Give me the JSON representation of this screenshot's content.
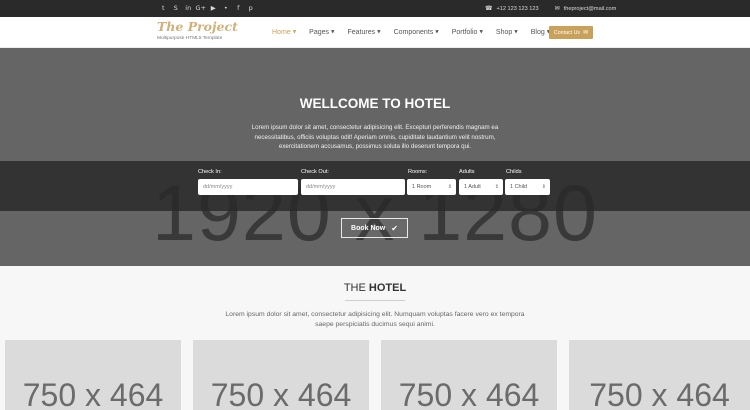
{
  "topbar": {
    "social": [
      {
        "icon": "twitter-icon",
        "glyph": "t"
      },
      {
        "icon": "skype-icon",
        "glyph": "S"
      },
      {
        "icon": "linkedin-icon",
        "glyph": "in"
      },
      {
        "icon": "google-plus-icon",
        "glyph": "G+"
      },
      {
        "icon": "youtube-icon",
        "glyph": "▶"
      },
      {
        "icon": "flickr-icon",
        "glyph": "•"
      },
      {
        "icon": "facebook-icon",
        "glyph": "f"
      },
      {
        "icon": "pinterest-icon",
        "glyph": "p"
      }
    ],
    "phone": "+12 123 123 123",
    "email": "theproject@mail.com"
  },
  "header": {
    "logo": "The Project",
    "tagline": "Multipurpose HTML5 Template",
    "nav": [
      {
        "label": "Home",
        "active": true
      },
      {
        "label": "Pages",
        "active": false
      },
      {
        "label": "Features",
        "active": false
      },
      {
        "label": "Components",
        "active": false
      },
      {
        "label": "Portfolio",
        "active": false
      },
      {
        "label": "Shop",
        "active": false
      },
      {
        "label": "Blog",
        "active": false
      }
    ],
    "contact_button": "Contact Us"
  },
  "hero": {
    "title": "WELLCOME TO HOTEL",
    "text": "Lorem ipsum dolor sit amet, consectetur adipisicing elit. Excepturi perferendis magnam ea necessitatibus, officiis voluptas odit! Aperiam omnis, cupiditate laudantium velit nostrum, exercitationem accusamus, possimus soluta illo deserunt tempora qui.",
    "placeholder": "1920 x 1280",
    "booking": {
      "check_in_label": "Check In:",
      "check_in_placeholder": "dd/mm/yyyy",
      "check_out_label": "Check Out:",
      "check_out_placeholder": "dd/mm/yyyy",
      "rooms_label": "Rooms:",
      "rooms_value": "1 Room",
      "adults_label": "Adults",
      "adults_value": "1 Adult",
      "childs_label": "Childs",
      "childs_value": "1 Child",
      "book_button": "Book Now"
    }
  },
  "section": {
    "title_light": "THE ",
    "title_bold": "HOTEL",
    "text": "Lorem ipsum dolor sit amet, consectetur adipisicing elit. Numquam voluptas facere vero ex tempora saepe perspiciatis ducimus sequi animi."
  },
  "cards": [
    {
      "placeholder": "750 x 464"
    },
    {
      "placeholder": "750 x 464"
    },
    {
      "placeholder": "750 x 464"
    },
    {
      "placeholder": "750 x 464"
    }
  ],
  "colors": {
    "accent": "#c9a15a",
    "topbar_bg": "#2a2a2a",
    "hero_bg": "#656565",
    "booking_bg": "#333333"
  }
}
